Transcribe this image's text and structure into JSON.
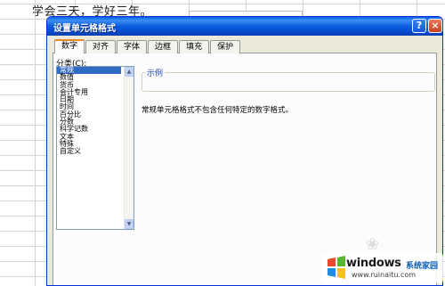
{
  "sheet": {
    "cell_text": "学会三天，学好三年。"
  },
  "dialog": {
    "title": "设置单元格格式",
    "help_label": "?",
    "close_label": "×",
    "tabs": [
      {
        "label": "数字",
        "active": true
      },
      {
        "label": "对齐",
        "active": false
      },
      {
        "label": "字体",
        "active": false
      },
      {
        "label": "边框",
        "active": false
      },
      {
        "label": "填充",
        "active": false
      },
      {
        "label": "保护",
        "active": false
      }
    ],
    "category_label": "分类(C):",
    "categories": [
      "常规",
      "数值",
      "货币",
      "会计专用",
      "日期",
      "时间",
      "百分比",
      "分数",
      "科学记数",
      "文本",
      "特殊",
      "自定义"
    ],
    "selected_category": "常规",
    "sample_title": "示例",
    "description": "常规单元格格式不包含任何特定的数字格式。"
  },
  "watermark": {
    "brand": "windows",
    "brand_suffix": "系统家园",
    "url": "www.ruinaitu.com"
  },
  "colors": {
    "titlebar": "#0a5ce0",
    "dialog_bg": "#ece9d8",
    "selected_item": "#316ac5",
    "active_tab_accent": "#e68b2c"
  }
}
